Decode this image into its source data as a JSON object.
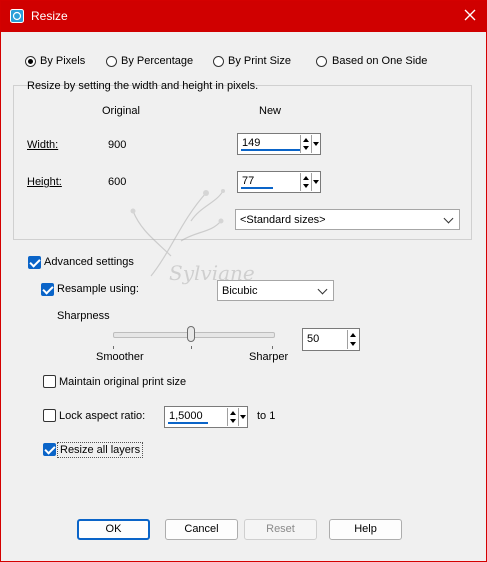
{
  "window": {
    "title": "Resize"
  },
  "modes": [
    {
      "label": "By Pixels",
      "checked": true
    },
    {
      "label": "By Percentage",
      "checked": false
    },
    {
      "label": "By Print Size",
      "checked": false
    },
    {
      "label": "Based on One Side",
      "checked": false
    }
  ],
  "pixels": {
    "description": "Resize by setting the width and height in pixels.",
    "col_original": "Original",
    "col_new": "New",
    "width_label": "Width:",
    "height_label": "Height:",
    "width_original": "900",
    "height_original": "600",
    "width_new": "149",
    "height_new": "77",
    "standard_sizes": "<Standard sizes>"
  },
  "advanced": {
    "label": "Advanced settings",
    "resample_label": "Resample using:",
    "resample_value": "Bicubic",
    "sharpness_label": "Sharpness",
    "smoother": "Smoother",
    "sharper": "Sharper",
    "sharpness_value": "50",
    "maintain_print": "Maintain original print size",
    "lock_aspect": "Lock aspect ratio:",
    "aspect_value": "1,5000",
    "to_one": "to 1",
    "resize_layers": "Resize all layers"
  },
  "checks": {
    "advanced": true,
    "resample": true,
    "maintain_print": false,
    "lock_aspect": false,
    "resize_layers": true
  },
  "watermark": {
    "text": "Sylviane"
  },
  "buttons": {
    "ok": "OK",
    "cancel": "Cancel",
    "reset": "Reset",
    "help": "Help"
  },
  "colors": {
    "titlebar": "#d00000",
    "accent": "#0a64c8"
  }
}
